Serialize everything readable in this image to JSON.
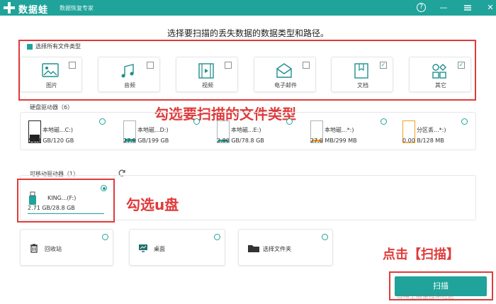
{
  "app": {
    "name": "数据蛙",
    "slogan": "数据恢复专家",
    "help_glyph": "?",
    "minimize_glyph": "—",
    "close_glyph": "✕"
  },
  "heading": "选择要扫描的丢失数据的数据类型和路径。",
  "file_types": {
    "select_all_label": "选择所有文件类型",
    "items": [
      {
        "label": "图片",
        "checked": false,
        "icon": "image-icon"
      },
      {
        "label": "音频",
        "checked": false,
        "icon": "audio-icon"
      },
      {
        "label": "视频",
        "checked": false,
        "icon": "video-icon"
      },
      {
        "label": "电子邮件",
        "checked": false,
        "icon": "email-icon"
      },
      {
        "label": "文档",
        "checked": true,
        "icon": "document-icon"
      },
      {
        "label": "其它",
        "checked": true,
        "icon": "other-icon"
      }
    ]
  },
  "hard_drives": {
    "title": "硬盘驱动器（6）",
    "items": [
      {
        "name": "本地磁...C:)",
        "size": "59.8 GB/120 GB"
      },
      {
        "name": "本地磁...D:)",
        "size": "27.9 GB/199 GB"
      },
      {
        "name": "本地磁...E:)",
        "size": "2.80 GB/78.8 GB"
      },
      {
        "name": "本地磁...*:)",
        "size": "27.0 MB/299 MB"
      },
      {
        "name": "分区丢...*:)",
        "size": "0.00 B/128 MB"
      }
    ]
  },
  "removable": {
    "title": "可移动驱动器（1）",
    "drive_name": "KING...(F:)",
    "drive_size": "2.71 GB/28.8 GB"
  },
  "locations": [
    {
      "label": "回收站",
      "icon": "recycle-bin-icon"
    },
    {
      "label": "桌面",
      "icon": "desktop-icon"
    },
    {
      "label": "选择文件夹",
      "icon": "folder-icon"
    }
  ],
  "annotations": {
    "file_types": "勾选要扫描的文件类型",
    "usb": "勾选u盘",
    "scan": "点击【扫描】"
  },
  "scan_button": "扫描",
  "watermark": "@稀土掘金技术社区",
  "colors": {
    "accent": "#1fa39a",
    "annotation": "#e03a3a"
  }
}
